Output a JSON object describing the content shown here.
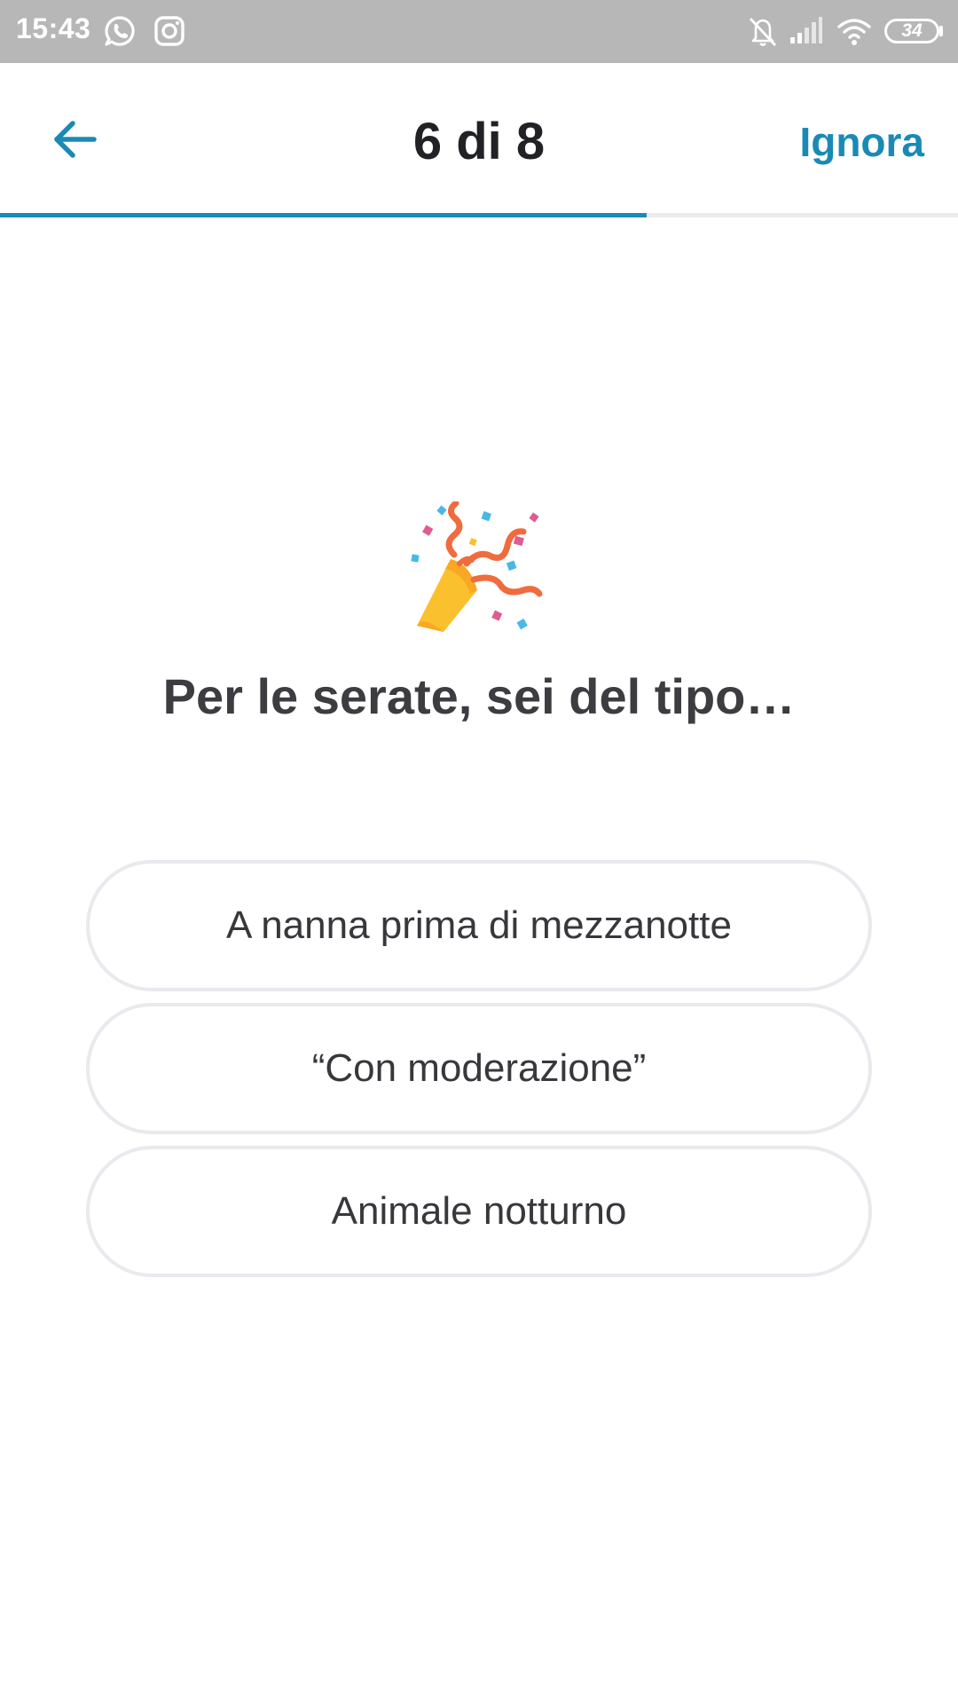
{
  "status_bar": {
    "time": "15:43",
    "battery": "34",
    "icons": [
      "whatsapp-icon",
      "instagram-icon",
      "bell-off-icon",
      "signal-icon",
      "wifi-icon",
      "battery-icon"
    ]
  },
  "header": {
    "back_icon": "arrow-left-icon",
    "title": "6 di 8",
    "skip_label": "Ignora"
  },
  "progress": {
    "current": 6,
    "total": 8,
    "fraction": 0.75
  },
  "question": {
    "emoji": "party-popper-icon",
    "text": "Per le serate, sei del tipo…"
  },
  "options": [
    {
      "label": "A nanna prima di mezzanotte"
    },
    {
      "label": "“Con moderazione”"
    },
    {
      "label": "Animale notturno"
    }
  ],
  "colors": {
    "accent": "#1a8ab5",
    "status_bar": "#b7b7b7",
    "option_border": "#e9e9ee",
    "text_dark": "#3c3c41"
  }
}
